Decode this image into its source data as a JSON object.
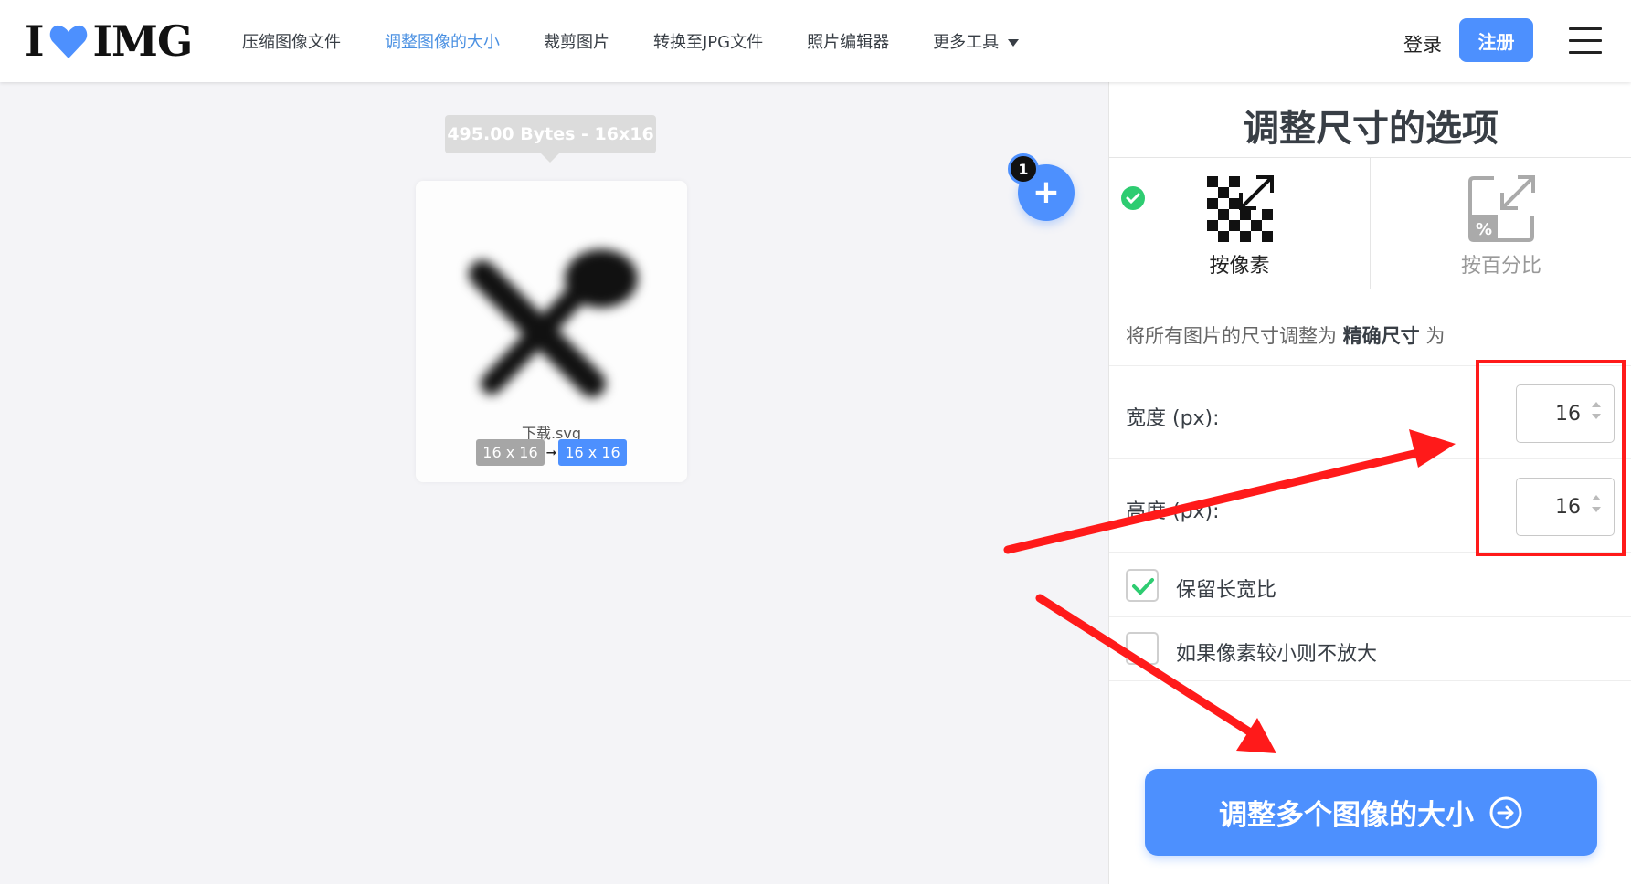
{
  "header": {
    "logo_text_left": "I",
    "logo_text_right": "IMG",
    "nav": [
      {
        "label": "压缩图像文件"
      },
      {
        "label": "调整图像的大小"
      },
      {
        "label": "裁剪图片"
      },
      {
        "label": "转换至JPG文件"
      },
      {
        "label": "照片编辑器"
      },
      {
        "label": "更多工具"
      }
    ],
    "login_label": "登录",
    "signup_label": "注册"
  },
  "workspace": {
    "file_tooltip": "495.00 Bytes - 16x16",
    "file_name": "下载.svg",
    "original_dims": "16 x 16",
    "new_dims": "16 x 16",
    "dims_arrow": "➞",
    "file_count": "1",
    "add_label": "+"
  },
  "sidebar": {
    "title": "调整尺寸的选项",
    "mode_pixels_label": "按像素",
    "mode_percent_label": "按百分比",
    "mode_selected": "按像素",
    "desc_prefix": "将所有图片的尺寸调整为 ",
    "desc_bold": "精确尺寸",
    "desc_suffix": " 为",
    "width_label": "宽度 (px):",
    "width_value": "16",
    "height_label": "高度 (px):",
    "height_value": "16",
    "keep_ratio_label": "保留长宽比",
    "keep_ratio_checked": true,
    "no_enlarge_label": "如果像素较小则不放大",
    "no_enlarge_checked": false,
    "submit_label": "调整多个图像的大小"
  },
  "colors": {
    "accent": "#4d90fe",
    "success": "#2ecc71",
    "annotation": "#ff1a1a"
  }
}
